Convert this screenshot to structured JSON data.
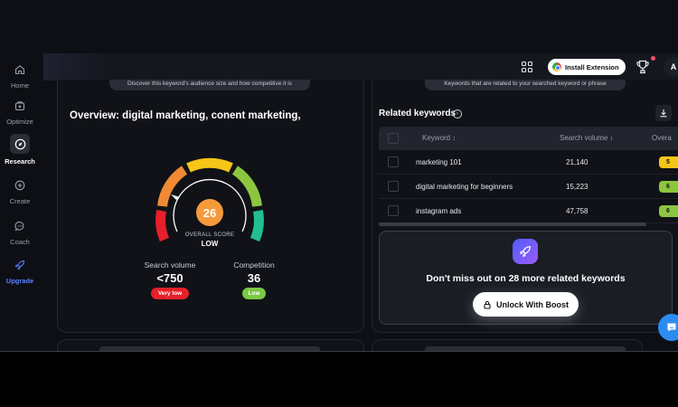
{
  "sidebar": {
    "items": [
      {
        "label": "Home",
        "icon": "home-icon"
      },
      {
        "label": "Optimize",
        "icon": "optimize-icon"
      },
      {
        "label": "Research",
        "icon": "compass-icon"
      },
      {
        "label": "Create",
        "icon": "plus-circle-icon"
      },
      {
        "label": "Coach",
        "icon": "chat-bubble-icon"
      },
      {
        "label": "Upgrade",
        "icon": "rocket-icon"
      }
    ]
  },
  "topbar": {
    "install_label": "Install Extension",
    "avatar_initial": "A"
  },
  "overview": {
    "tab_hint": "Discover this keyword's audience size and how competitive it is",
    "title": "Overview: digital marketing, conent marketing,",
    "score": "26",
    "score_caption": "OVERALL SCORE",
    "score_level": "LOW",
    "score_value": 26,
    "search_volume_label": "Search volume",
    "search_volume_value": "<750",
    "search_volume_badge": "Very low",
    "competition_label": "Competition",
    "competition_value": "36",
    "competition_badge": "Low"
  },
  "related": {
    "tab_hint": "Keywords that are related to your searched keyword or phrase",
    "title": "Related keywords",
    "columns": [
      "Keyword",
      "Search volume",
      "Overa"
    ],
    "rows": [
      {
        "keyword": "marketing 101",
        "volume": "21,140",
        "overall": "5"
      },
      {
        "keyword": "digital marketing for beginners",
        "volume": "15,223",
        "overall": "6"
      },
      {
        "keyword": "instagram ads",
        "volume": "47,758",
        "overall": "6"
      }
    ],
    "boost_text": "Don't miss out on 28 more related keywords",
    "unlock_label": "Unlock With Boost"
  },
  "colors": {
    "accent": "#5b82ff",
    "score_orange": "#f59a3a",
    "very_low_red": "#e5202a",
    "low_green": "#7ac943"
  }
}
